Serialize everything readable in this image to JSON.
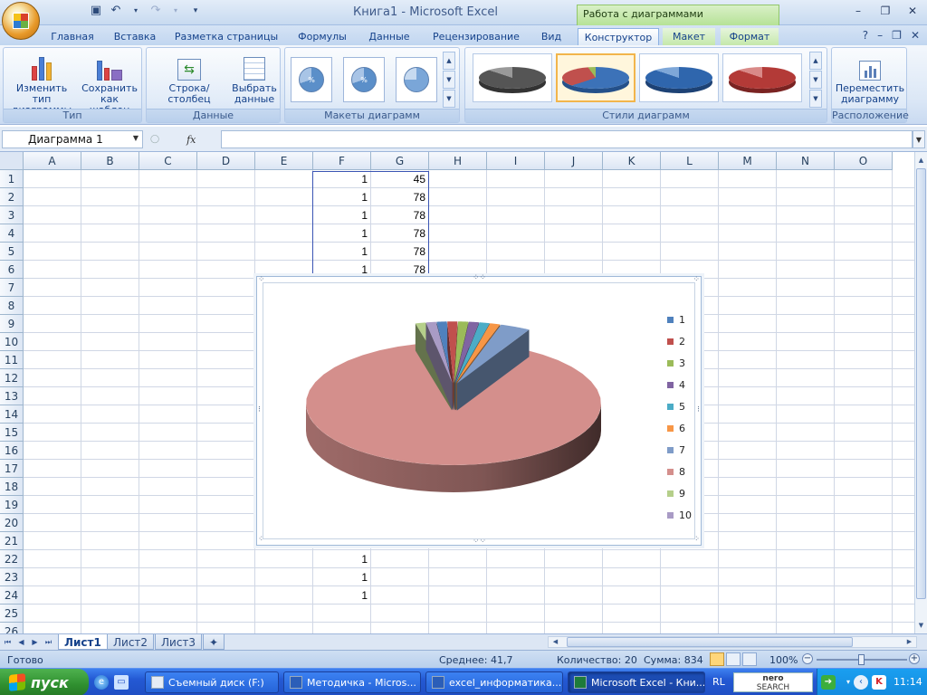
{
  "window": {
    "title": "Книга1  -  Microsoft Excel",
    "context_tab_group": "Работа с диаграммами",
    "controls": [
      "–",
      "❐",
      "✕"
    ]
  },
  "tabs": [
    "Главная",
    "Вставка",
    "Разметка страницы",
    "Формулы",
    "Данные",
    "Рецензирование",
    "Вид",
    "Конструктор",
    "Макет",
    "Формат"
  ],
  "active_tab": "Конструктор",
  "ribbon": {
    "groups": {
      "type": "Тип",
      "data": "Данные",
      "layouts": "Макеты диаграмм",
      "styles": "Стили диаграмм",
      "location": "Расположение"
    },
    "buttons": {
      "change_type_1": "Изменить тип",
      "change_type_2": "диаграммы",
      "save_template_1": "Сохранить",
      "save_template_2": "как шаблон",
      "row_col": "Строка/столбец",
      "select_data_1": "Выбрать",
      "select_data_2": "данные",
      "move_chart_1": "Переместить",
      "move_chart_2": "диаграмму"
    },
    "layout_thumb_label": "%"
  },
  "formula_bar": {
    "name_box": "Диаграмма 1",
    "fx": "fx",
    "formula": ""
  },
  "columns": [
    "A",
    "B",
    "C",
    "D",
    "E",
    "F",
    "G",
    "H",
    "I",
    "J",
    "K",
    "L",
    "M",
    "N",
    "O"
  ],
  "rows": [
    "1",
    "2",
    "3",
    "4",
    "5",
    "6",
    "7",
    "8",
    "9",
    "10",
    "11",
    "12",
    "13",
    "14",
    "15",
    "16",
    "17",
    "18",
    "19",
    "20",
    "21",
    "22",
    "23",
    "24",
    "25",
    "26"
  ],
  "cells": {
    "F": [
      "1",
      "1",
      "1",
      "1",
      "1",
      "1",
      "",
      "",
      "",
      "",
      "",
      "",
      "",
      "",
      "",
      "",
      "",
      "",
      "",
      "",
      "1",
      "1",
      "1",
      "1"
    ],
    "G": [
      "45",
      "78",
      "78",
      "78",
      "78",
      "78"
    ]
  },
  "chart_data": {
    "type": "pie",
    "style": "3d",
    "categories": [
      "1",
      "2",
      "3",
      "4",
      "5",
      "6",
      "7",
      "8",
      "9",
      "10"
    ],
    "series": [
      {
        "values": [
          1,
          1,
          1,
          1,
          1,
          1,
          3,
          80,
          1,
          1
        ]
      }
    ],
    "colors": [
      "#4f81bd",
      "#c0504d",
      "#9bbb59",
      "#8064a2",
      "#4bacc6",
      "#f79646",
      "#7f9cc8",
      "#d48f8c",
      "#b5cf8a",
      "#a99bc5"
    ],
    "legend": "right"
  },
  "sheets": [
    "Лист1",
    "Лист2",
    "Лист3"
  ],
  "active_sheet": "Лист1",
  "status": {
    "ready": "Готово",
    "average": "Среднее: 41,7",
    "count": "Количество: 20",
    "sum": "Сумма: 834",
    "zoom": "100%"
  },
  "taskbar": {
    "start": "пуск",
    "items": [
      "Съемный диск (F:)",
      "Методичка - Micros...",
      "excel_информатика...",
      "Microsoft Excel - Кни..."
    ],
    "lang": "RL",
    "nero_1": "nero",
    "nero_2": "SEARCH",
    "clock": "11:14"
  }
}
